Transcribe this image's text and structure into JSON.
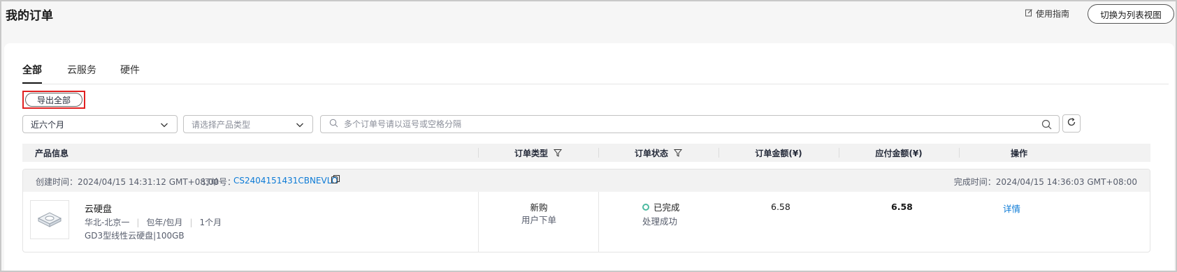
{
  "header": {
    "title": "我的订单",
    "guide_label": "使用指南",
    "switch_view_label": "切换为列表视图"
  },
  "tabs": [
    {
      "label": "全部",
      "active": true
    },
    {
      "label": "云服务",
      "active": false
    },
    {
      "label": "硬件",
      "active": false
    }
  ],
  "toolbar": {
    "export_label": "导出全部"
  },
  "filters": {
    "time_range_value": "近六个月",
    "product_type_placeholder": "请选择产品类型",
    "search_placeholder": "多个订单号请以逗号或空格分隔"
  },
  "table": {
    "columns": {
      "product_info": "产品信息",
      "order_type": "订单类型",
      "order_status": "订单状态",
      "order_amount": "订单金额(¥)",
      "payable_amount": "应付金额(¥)",
      "actions": "操作"
    }
  },
  "orders": [
    {
      "created_time": "创建时间：2024/04/15 14:31:12 GMT+08:00",
      "order_no_label": "订单号：",
      "order_no": "CS2404151431CBNEVLO",
      "completed_time": "完成时间：2024/04/15 14:36:03 GMT+08:00",
      "product_name": "云硬盘",
      "region": "华北-北京一",
      "billing": "包年/包月",
      "duration": "1个月",
      "spec": "GD3型线性云硬盘|100GB",
      "order_type": "新购",
      "order_type_sub": "用户下单",
      "status": "已完成",
      "status_sub": "处理成功",
      "order_amount": "6.58",
      "payable_amount": "6.58",
      "action_label": "详情"
    }
  ],
  "colors": {
    "link": "#0d7bd6",
    "status_done": "#4cbaa0",
    "highlight_border": "#e02020"
  },
  "icons": [
    "edit-doc-icon",
    "chevron-down-icon",
    "search-icon",
    "refresh-icon",
    "filter-icon",
    "copy-icon",
    "disk-icon"
  ]
}
